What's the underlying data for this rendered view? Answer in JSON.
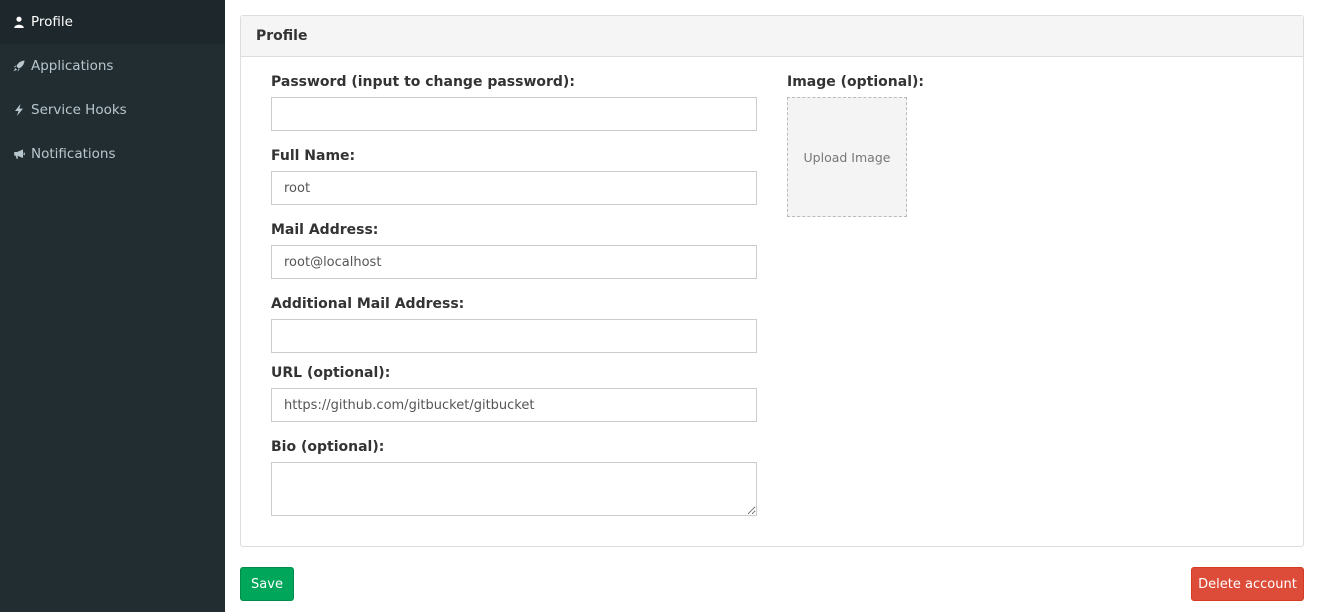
{
  "sidebar": {
    "items": [
      {
        "label": "Profile",
        "icon": "person-icon",
        "active": true
      },
      {
        "label": "Applications",
        "icon": "rocket-icon"
      },
      {
        "label": "Service Hooks",
        "icon": "zap-icon"
      },
      {
        "label": "Notifications",
        "icon": "megaphone-icon"
      }
    ]
  },
  "panel": {
    "title": "Profile"
  },
  "form": {
    "password": {
      "label": "Password (input to change password):",
      "value": ""
    },
    "full_name": {
      "label": "Full Name:",
      "value": "root"
    },
    "mail_address": {
      "label": "Mail Address:",
      "value": "root@localhost"
    },
    "additional_mail": {
      "label": "Additional Mail Address:",
      "value": ""
    },
    "url": {
      "label": "URL (optional):",
      "value": "https://github.com/gitbucket/gitbucket"
    },
    "bio": {
      "label": "Bio (optional):",
      "value": ""
    },
    "image": {
      "label": "Image (optional):",
      "upload_text": "Upload Image"
    }
  },
  "actions": {
    "save_label": "Save",
    "delete_label": "Delete account"
  },
  "colors": {
    "sidebar_bg": "#222d32",
    "save": "#00a65a",
    "delete": "#dd4b39"
  }
}
